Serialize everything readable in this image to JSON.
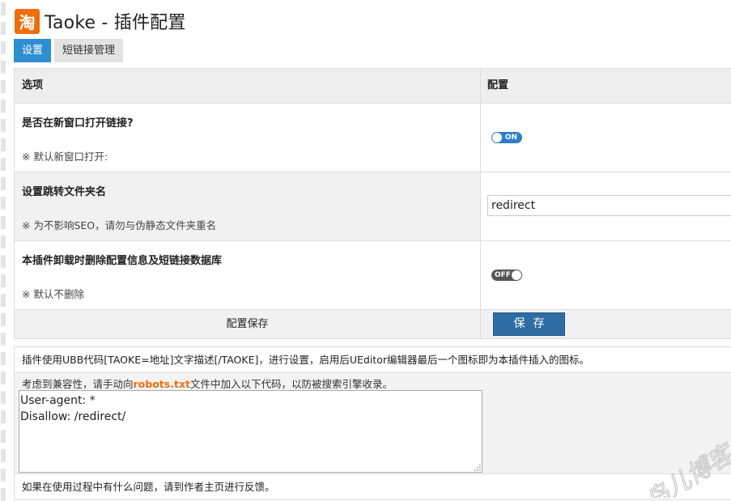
{
  "header": {
    "logo_text": "淘",
    "title": "Taoke - 插件配置"
  },
  "tabs": [
    {
      "label": "设置",
      "active": true
    },
    {
      "label": "短链接管理",
      "active": false
    }
  ],
  "config_table": {
    "col_option": "选项",
    "col_config": "配置",
    "rows": [
      {
        "question": "是否在新窗口打开链接?",
        "desc": "※ 默认新窗口打开:",
        "control": "toggle",
        "toggle_text": "ON",
        "value": true
      },
      {
        "question": "设置跳转文件夹名",
        "desc": "※ 为不影响SEO，请勿与伪静态文件夹重名",
        "control": "text",
        "value": "redirect"
      },
      {
        "question": "本插件卸载时删除配置信息及短链接数据库",
        "desc": "※ 默认不删除",
        "control": "toggle",
        "toggle_text": "OFF",
        "value": false
      }
    ],
    "save_label": "配置保存",
    "save_button": "保存"
  },
  "info": {
    "line1": "插件使用UBB代码[TAOKE=地址]文字描述[/TAOKE]，进行设置，启用后UEditor编辑器最后一个图标即为本插件插入的图标。",
    "hint_prefix": "考虑到兼容性，请手动向",
    "hint_highlight": "robots.txt",
    "hint_suffix": "文件中加入以下代码，以防被搜索引擎收录。",
    "code": "User-agent: *\nDisallow: /redirect/",
    "line3": "如果在使用过程中有什么问题，请到作者主页进行反馈。"
  },
  "watermark_text": "鸟儿博客",
  "colors": {
    "accent": "#2e8ed2",
    "logo": "#ef6e0c",
    "save_button": "#2e6da4",
    "highlight": "#ef6e0c"
  }
}
